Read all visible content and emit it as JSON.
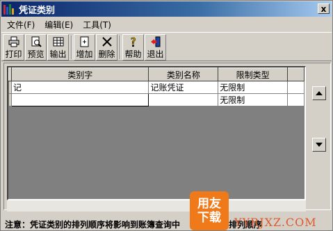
{
  "window": {
    "title": "凭证类别",
    "close_symbol": "x"
  },
  "menu": [
    {
      "label": "文件(F)"
    },
    {
      "label": "编辑(E)"
    },
    {
      "label": "工具(T)"
    }
  ],
  "toolbar": {
    "print": "打印",
    "preview": "预览",
    "export": "输出",
    "add": "增加",
    "delete": "删除",
    "help": "帮助",
    "exit": "退出"
  },
  "grid": {
    "columns": [
      "类别字",
      "类别名称",
      "限制类型"
    ],
    "rows": [
      {
        "code": "记",
        "name": "记账凭证",
        "limit": "无限制"
      },
      {
        "code": "",
        "name": "",
        "limit": "无限制"
      }
    ]
  },
  "side_buttons": {
    "up_icon": "triangle-up-icon",
    "down_icon": "triangle-down-icon"
  },
  "notice": "注意：凭证类别的排列顺序将影响到账簿查询中",
  "notice_tail": "的排列顺序",
  "watermark": {
    "line1": "用友",
    "line2": "下载",
    "url": "YYRJXZ.COM",
    "color": "#f07a1a"
  },
  "colors": {
    "titlebar_start": "#0a246a",
    "window_bg": "#d4d0c8",
    "grid_bg": "#808080"
  }
}
